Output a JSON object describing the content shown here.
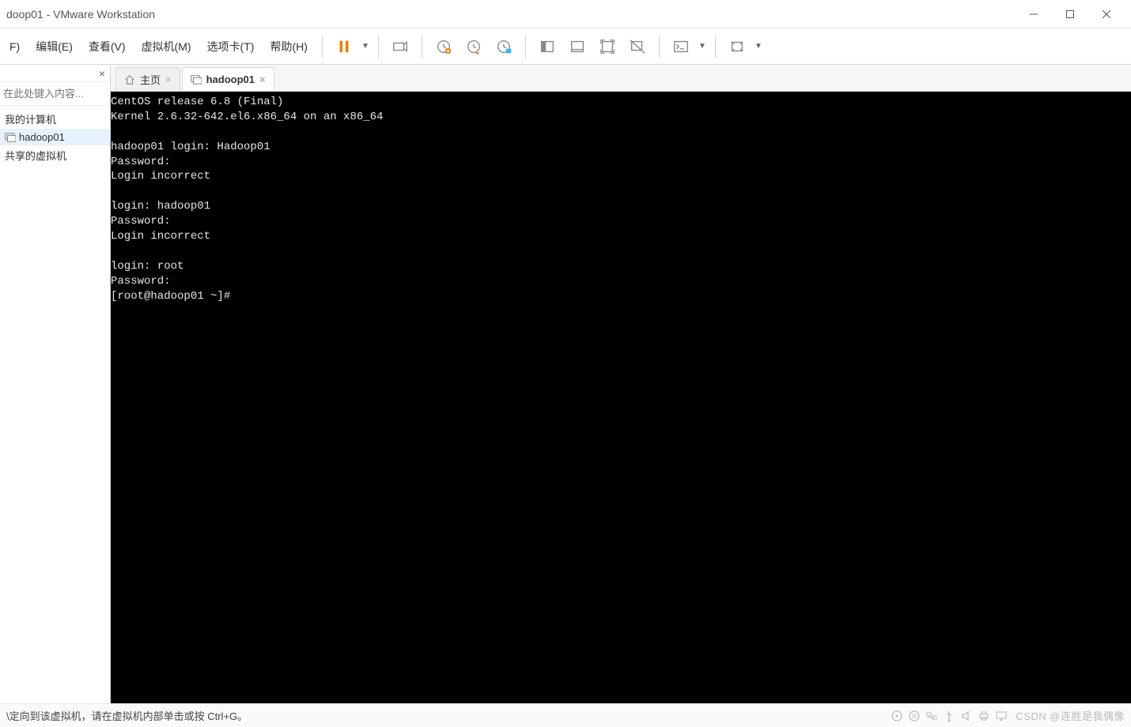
{
  "window": {
    "title": "doop01 - VMware Workstation"
  },
  "menu": {
    "file": "F)",
    "edit": "编辑(E)",
    "view": "查看(V)",
    "vm": "虚拟机(M)",
    "tabs": "选项卡(T)",
    "help": "帮助(H)"
  },
  "sidebar": {
    "search_placeholder": "在此处键入内容...",
    "items": [
      {
        "label": "我的计算机"
      },
      {
        "label": "hadoop01",
        "selected": true
      },
      {
        "label": "共享的虚拟机"
      }
    ]
  },
  "tabs": {
    "home_label": "主页",
    "vm_label": "hadoop01"
  },
  "terminal": {
    "lines": [
      "CentOS release 6.8 (Final)",
      "Kernel 2.6.32-642.el6.x86_64 on an x86_64",
      "",
      "hadoop01 login: Hadoop01",
      "Password:",
      "Login incorrect",
      "",
      "login: hadoop01",
      "Password:",
      "Login incorrect",
      "",
      "login: root",
      "Password:",
      "[root@hadoop01 ~]#"
    ]
  },
  "statusbar": {
    "message": "\\定向到该虚拟机，请在虚拟机内部单击或按 Ctrl+G。",
    "watermark": "CSDN @连胜是我偶像"
  }
}
